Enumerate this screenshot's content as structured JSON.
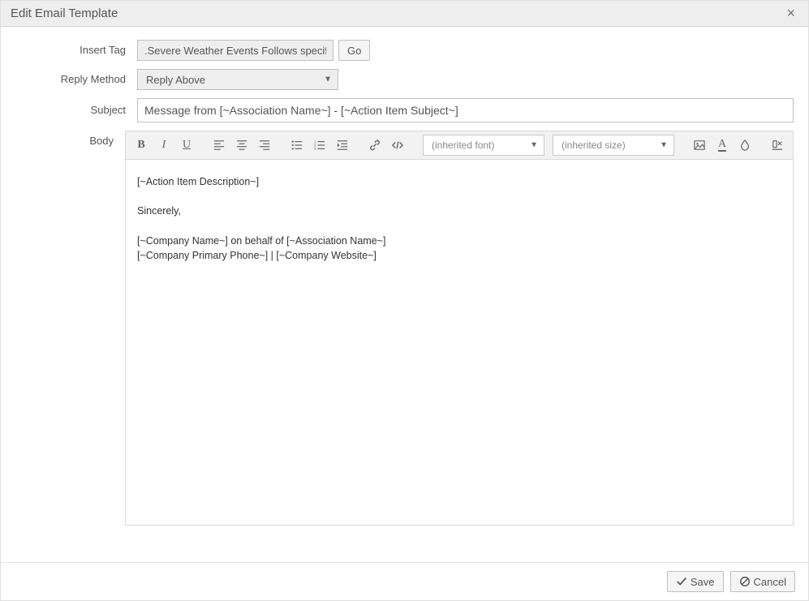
{
  "dialog": {
    "title": "Edit Email Template"
  },
  "labels": {
    "insert_tag": "Insert Tag",
    "reply_method": "Reply Method",
    "subject": "Subject",
    "body": "Body"
  },
  "insert_tag": {
    "value": ".Severe Weather Events Follows specific",
    "go_label": "Go"
  },
  "reply_method": {
    "selected": "Reply Above"
  },
  "subject": {
    "value": "Message from [~Association Name~] - [~Action Item Subject~]"
  },
  "toolbar": {
    "font_placeholder": "(inherited font)",
    "size_placeholder": "(inherited size)"
  },
  "body_text": "[~Action Item Description~]\n\nSincerely,\n\n[~Company Name~] on behalf of [~Association Name~]\n[~Company Primary Phone~] | [~Company Website~]",
  "footer": {
    "save": "Save",
    "cancel": "Cancel"
  }
}
